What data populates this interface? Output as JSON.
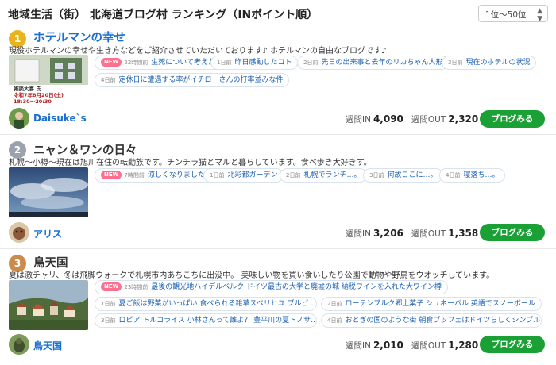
{
  "header": {
    "title": "地域生活（街） 北海道ブログ村 ランキング（INポイント順）",
    "range_select": "1位〜50位"
  },
  "labels": {
    "new": "NEW",
    "in": "週間IN",
    "out": "週間OUT",
    "button": "ブログみる"
  },
  "colors": {
    "accent": "#1a6fcf",
    "button": "#1aa035",
    "new_badge": "#ff6f8f",
    "rank_gold": "#e8b31b",
    "rank_silver": "#9aa3ad",
    "rank_bronze": "#c98b4e"
  },
  "blogs": [
    {
      "rank": "1",
      "title": "ホテルマンの幸せ",
      "description": "現役ホテルマンの幸せや生き方などをご紹介させていただいております♪ ホテルマンの自由なブログです♪",
      "thumb_text": [
        "雑談大喜 氏",
        "令和7年8月20日(土)",
        "18:30〜20:30"
      ],
      "blogger": "Daisuke`s",
      "in": "4,090",
      "out": "2,320",
      "entries": [
        {
          "new": true,
          "ago": "22時間前",
          "text": "生死について考えた朝"
        },
        {
          "new": false,
          "ago": "1日前",
          "text": "昨日感動したコト"
        },
        {
          "new": false,
          "ago": "2日前",
          "text": "先日の出来事と去年のリカちゃん人形"
        },
        {
          "new": false,
          "ago": "3日前",
          "text": "現在のホテルの状況"
        },
        {
          "new": false,
          "ago": "4日前",
          "text": "定休日に遭遇する率がイチローさんの打率並みな件"
        }
      ]
    },
    {
      "rank": "2",
      "title": "ニャン＆ワンの日々",
      "description": "札幌〜小樽〜現在は旭川在住の転勤族です。チンチラ猫とマルと暮らしています。食べ歩き大好きす。",
      "blogger": "アリス",
      "in": "3,206",
      "out": "1,358",
      "entries": [
        {
          "new": true,
          "ago": "7時間前",
          "text": "涼しくなりました。"
        },
        {
          "new": false,
          "ago": "1日前",
          "text": "北彩都ガーデン"
        },
        {
          "new": false,
          "ago": "2日前",
          "text": "札幌でランチ…。"
        },
        {
          "new": false,
          "ago": "3日前",
          "text": "何故ここに…。"
        },
        {
          "new": false,
          "ago": "4日前",
          "text": "寝落ち…。"
        }
      ]
    },
    {
      "rank": "3",
      "title": "鳥天国",
      "description": "夏は激チャリ、冬は飛脚ウォークで札幌市内あちこちに出没中。 美味しい物を買い食いしたり公園で動物や野鳥をウオッチしています。",
      "blogger": "鳥天国",
      "in": "2,010",
      "out": "1,280",
      "entries": [
        {
          "new": true,
          "ago": "23時間前",
          "text": "最後の観光地ハイデルベルク ドイツ最古の大学と廃墟の城 納税ワインを入れた大ワイン樽"
        },
        {
          "new": false,
          "ago": "1日前",
          "text": "夏ご飯は野菜がいっぱい 食べられる雑草スベリヒユ ブルビ…"
        },
        {
          "new": false,
          "ago": "2日前",
          "text": "ローテンブルク郷土菓子 シュネーバル 英語でスノーボール …"
        },
        {
          "new": false,
          "ago": "3日前",
          "text": "ロピア トルコライス 小林さんって誰よ？ 豊平川の夏トノサ…"
        },
        {
          "new": false,
          "ago": "4日前",
          "text": "おとぎの国のような街 朝食ブッフェはドイツらしくシンプル…"
        }
      ]
    }
  ]
}
